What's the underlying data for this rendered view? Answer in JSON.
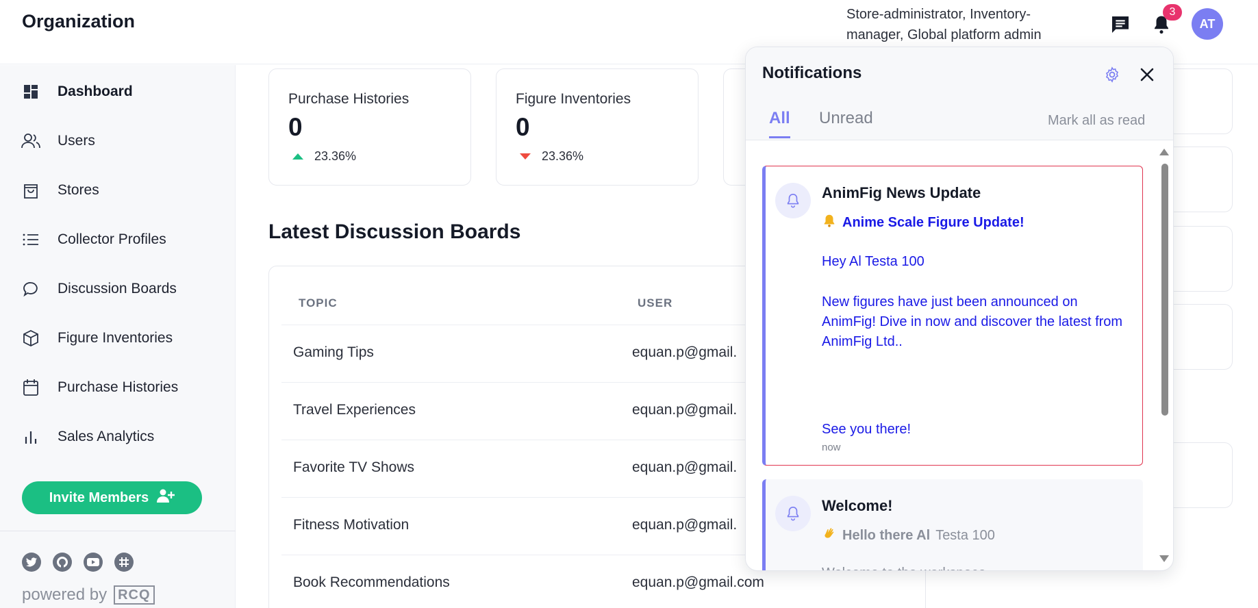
{
  "header": {
    "brand": "Organization",
    "roles": "Store-administrator, Inventory-manager, Global platform admin",
    "notification_count": "3",
    "avatar_initials": "AT"
  },
  "sidebar": {
    "items": [
      {
        "label": "Dashboard",
        "icon": "dashboard-icon",
        "active": true
      },
      {
        "label": "Users",
        "icon": "users-icon"
      },
      {
        "label": "Stores",
        "icon": "shopping-bag-icon"
      },
      {
        "label": "Collector Profiles",
        "icon": "list-icon"
      },
      {
        "label": "Discussion Boards",
        "icon": "chat-bubble-icon"
      },
      {
        "label": "Figure Inventories",
        "icon": "cube-icon"
      },
      {
        "label": "Purchase Histories",
        "icon": "calendar-icon"
      },
      {
        "label": "Sales Analytics",
        "icon": "bar-chart-icon"
      }
    ],
    "invite_label": "Invite Members",
    "powered_by": "powered by",
    "powered_logo": "RCQ"
  },
  "stats": [
    {
      "title": "Purchase Histories",
      "value": "0",
      "change": "23.36%",
      "direction": "up"
    },
    {
      "title": "Figure Inventories",
      "value": "0",
      "change": "23.36%",
      "direction": "down"
    }
  ],
  "discussion": {
    "title": "Latest Discussion Boards",
    "columns": [
      "TOPIC",
      "USER"
    ],
    "rows": [
      {
        "topic": "Gaming Tips",
        "user": "equan.p@gmail."
      },
      {
        "topic": "Travel Experiences",
        "user": "equan.p@gmail."
      },
      {
        "topic": "Favorite TV Shows",
        "user": "equan.p@gmail."
      },
      {
        "topic": "Fitness Motivation",
        "user": "equan.p@gmail."
      },
      {
        "topic": "Book Recommendations",
        "user": "equan.p@gmail.com"
      }
    ]
  },
  "notifications": {
    "title": "Notifications",
    "tabs": {
      "all": "All",
      "unread": "Unread"
    },
    "mark_all": "Mark all as read",
    "items": [
      {
        "title": "AnimFig News Update",
        "subtitle": "Anime Scale Figure Update!",
        "greeting": "Hey Al Testa 100",
        "body": "New figures have just been announced on AnimFig! Dive in now and discover the latest from AnimFig Ltd..",
        "closing": "See you there!",
        "time": "now"
      },
      {
        "title": "Welcome!",
        "subtitle_bold": "Hello there Al",
        "subtitle_rest": "Testa 100",
        "faded": "Welcome to the workspace"
      }
    ]
  },
  "colors": {
    "accent": "#7b7ef2",
    "green": "#1bbf83",
    "red": "#ef4b3f",
    "badge": "#e8336d",
    "link_blue": "#1a1ae6"
  }
}
